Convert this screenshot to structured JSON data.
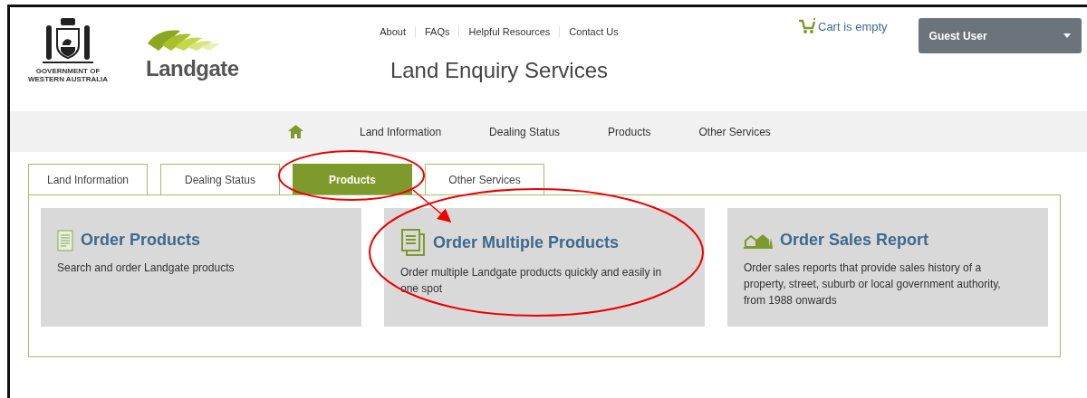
{
  "header": {
    "government_logo": {
      "lines": [
        "GOVERNMENT OF",
        "WESTERN AUSTRALIA"
      ]
    },
    "brand": "Landgate",
    "top_links": [
      "About",
      "FAQs",
      "Helpful Resources",
      "Contact Us"
    ],
    "site_title": "Land Enquiry Services",
    "cart": "Cart is empty",
    "user_menu": "Guest User"
  },
  "main_nav": {
    "items": [
      "Land Information",
      "Dealing Status",
      "Products",
      "Other Services"
    ]
  },
  "tabs": [
    {
      "label": "Land Information",
      "selected": false
    },
    {
      "label": "Dealing Status",
      "selected": false
    },
    {
      "label": "Products",
      "selected": true
    },
    {
      "label": "Other Services",
      "selected": false
    }
  ],
  "cards": [
    {
      "kind": "document",
      "title": "Order Products",
      "description": "Search and order Landgate products"
    },
    {
      "kind": "multiple",
      "title": "Order Multiple Products",
      "description": "Order multiple Landgate products quickly and easily in one spot"
    },
    {
      "kind": "property",
      "title": "Order Sales Report",
      "description": "Order sales reports that provide sales history of a property, street, suburb or local government authority, from 1988 onwards"
    }
  ]
}
